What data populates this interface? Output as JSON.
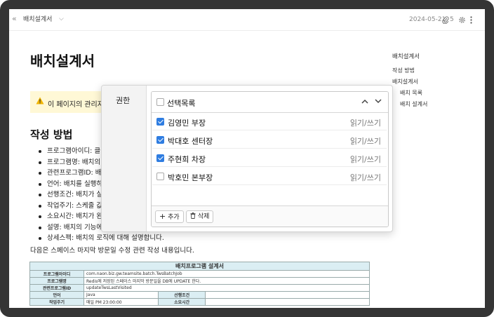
{
  "topbar": {
    "collapse_icon": "double-chevron-left-icon",
    "breadcrumb": "배치설계서",
    "date": "2024-05-21",
    "attachment_count": "5"
  },
  "page": {
    "title": "배치설계서",
    "notice_text": "이 페이지의 관리자",
    "section_title": "작성 방법",
    "bullets": [
      "프로그램아이디: 클",
      "프로그램명: 배치의",
      "관련프로그램ID: 배",
      "언어: 배치를 실행하",
      "선행조건: 배치가 실",
      "작업주기: 스케줄 값",
      "소요시간: 배치가 완",
      "설명: 배치의 기능에",
      "상세스펙: 배치의 로직에 대해 설명합니다."
    ],
    "paragraph": "다음은 스페이스 마지막 방문일 수정 관련 작성 내용입니다."
  },
  "toc": {
    "title": "배치설계서",
    "items": [
      "작성 방법",
      "배치설계서",
      "배치 목록",
      "배치 설계서"
    ]
  },
  "spec_table": {
    "title": "배치프로그램 설계서",
    "rows": [
      {
        "label": "프로그램아이디",
        "value": "com.naon.biz.gw.teamsite.batch.TwsBatchJob"
      },
      {
        "label": "프로그램명",
        "value": "Redis에 저장된 스페이스 마지막 방문일을 DB에 UPDATE 한다."
      },
      {
        "label": "관련프로그램ID",
        "value": "updateTwsLastVisited"
      }
    ],
    "lang_label": "언어",
    "lang_value": "Java",
    "precond_label": "선행조건",
    "cycle_label": "작업주기",
    "cycle_value": "매일 PM 23:00:00",
    "duration_label": "소요시간"
  },
  "permission_panel": {
    "label": "권한",
    "dropdown_title": "선택목록",
    "members": [
      {
        "name": "김영민 부장",
        "perm": "읽기/쓰기",
        "checked": true
      },
      {
        "name": "박대호 센터장",
        "perm": "읽기/쓰기",
        "checked": true
      },
      {
        "name": "주현희 차장",
        "perm": "읽기/쓰기",
        "checked": true
      },
      {
        "name": "박호민 본부장",
        "perm": "읽기/쓰기",
        "checked": false
      }
    ],
    "add_label": "추가",
    "delete_label": "삭제"
  },
  "colors": {
    "accent": "#2f7de1",
    "notice_bg": "#fff8d6",
    "table_header_bg": "#dbeef3"
  }
}
